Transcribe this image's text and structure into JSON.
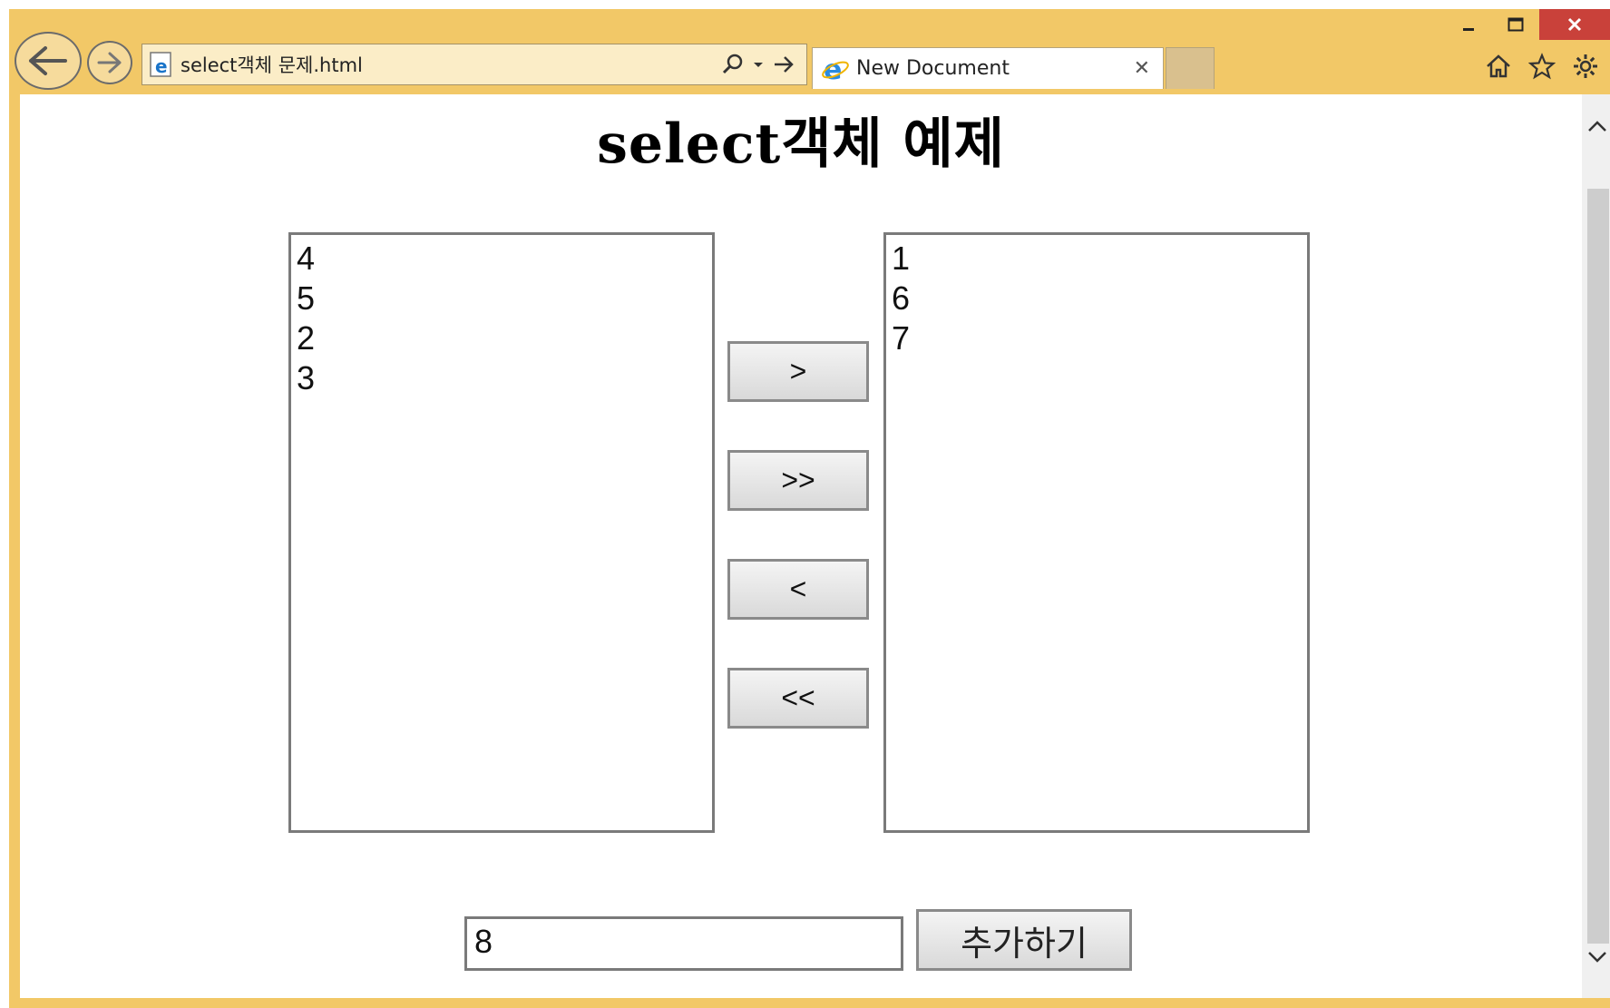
{
  "browser": {
    "address_text": "select객체 문제.html",
    "tab_title": "New Document",
    "accent_color": "#f2c867",
    "close_color": "#c9413a"
  },
  "page": {
    "title": "select객체  예제",
    "left_list": [
      "4",
      "5",
      "2",
      "3"
    ],
    "right_list": [
      "1",
      "6",
      "7"
    ],
    "buttons": {
      "move_right": ">",
      "move_all_right": ">>",
      "move_left": "<",
      "move_all_left": "<<",
      "add": "추가하기"
    },
    "input_value": "8"
  },
  "icons": [
    "back-arrow-icon",
    "forward-arrow-icon",
    "ie-page-icon",
    "search-icon",
    "go-arrow-icon",
    "ie-tab-icon",
    "home-icon",
    "star-icon",
    "gear-icon",
    "minimize-icon",
    "maximize-icon",
    "close-icon"
  ]
}
